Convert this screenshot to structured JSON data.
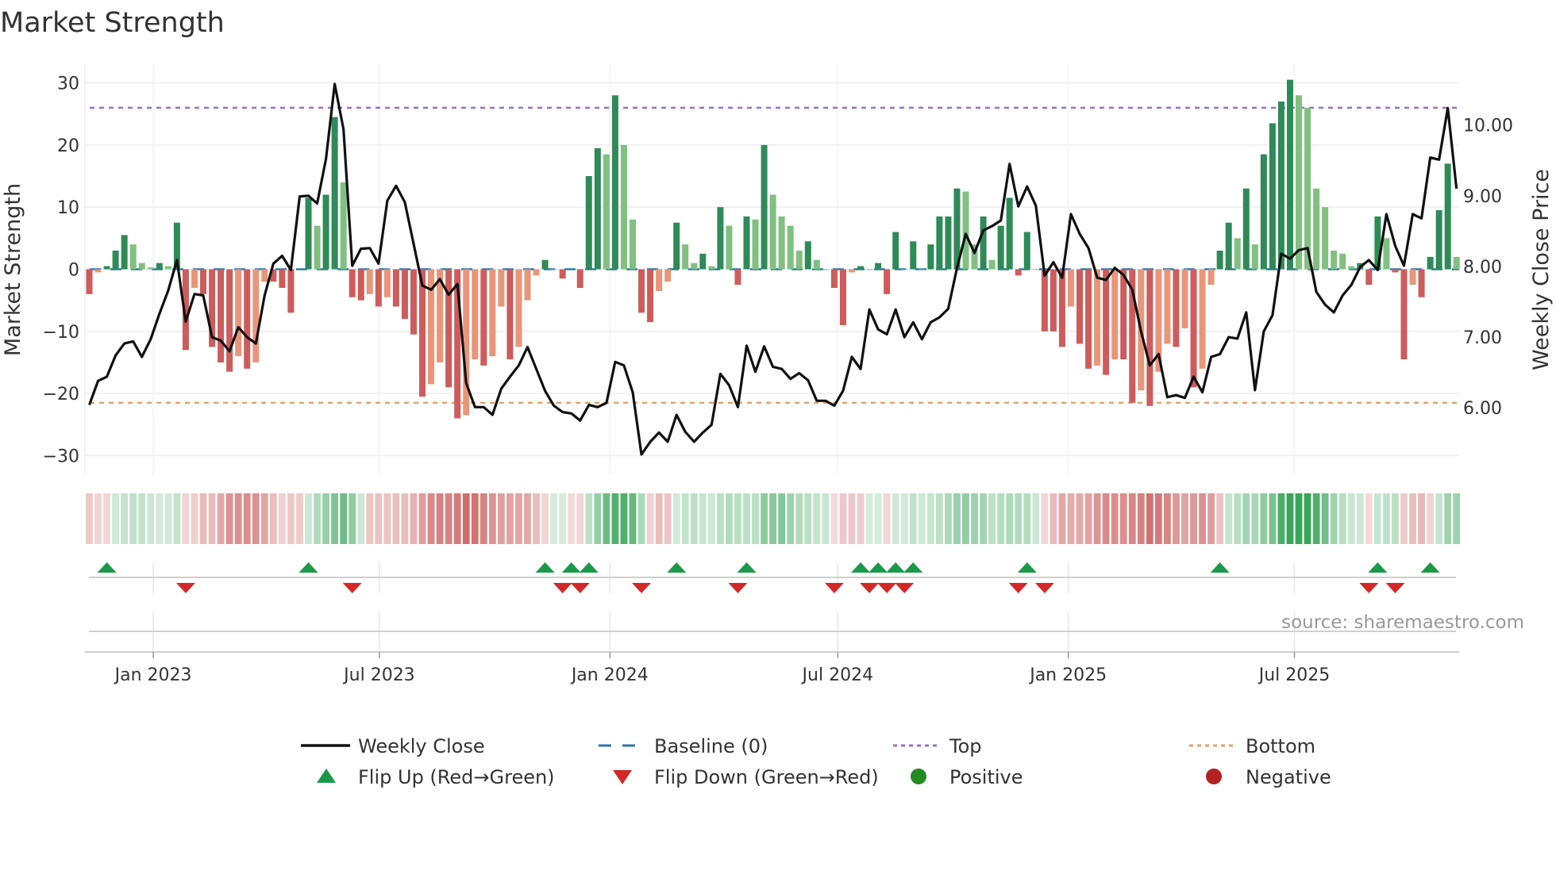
{
  "chart_data": {
    "type": "bar",
    "title": "Market Strength",
    "ylabel": "Market Strength",
    "y2label": "Weekly Close Price",
    "ylim": [
      -33,
      33
    ],
    "y2lim": [
      5.06,
      10.86
    ],
    "yticks": [
      30,
      20,
      10,
      0,
      -10,
      -20,
      -30
    ],
    "ytick_labels": [
      "30",
      "20",
      "10",
      "0",
      "−10",
      "−20",
      "−30"
    ],
    "y2ticks": [
      10,
      9,
      8,
      7,
      6
    ],
    "y2tick_labels": [
      "10.00",
      "9.00",
      "8.00",
      "7.00",
      "6.00"
    ],
    "xtick_labels": [
      "Jan 2023",
      "Jul 2023",
      "Jan 2024",
      "Jul 2024",
      "Jan 2025",
      "Jul 2025"
    ],
    "xtick_week_index": [
      7.3,
      33.1,
      59.4,
      85.4,
      111.7,
      137.5
    ],
    "grid": true,
    "top_level": 26,
    "bottom_level": -21.5,
    "baseline": 0,
    "strength": [
      -4,
      -0.5,
      0.5,
      3,
      5.5,
      4,
      1,
      0.3,
      1,
      0.5,
      7.5,
      -13,
      -3,
      -4,
      -12.5,
      -15,
      -16.5,
      -14,
      -16,
      -15,
      -2,
      -2,
      -3,
      -7,
      0,
      11.5,
      7,
      12,
      24.5,
      14,
      -4.5,
      -5,
      -4,
      -6,
      -4.5,
      -6,
      -8,
      -10.5,
      -20.5,
      -18.5,
      -15,
      -19,
      -24,
      -23.5,
      -14.5,
      -15.5,
      -14,
      -6,
      -14.5,
      -12.5,
      -5,
      -1,
      1.5,
      0,
      -1.5,
      0,
      -3,
      15,
      19.5,
      18.5,
      28,
      20,
      8,
      -7,
      -8.5,
      -3.5,
      -2,
      7.5,
      4,
      1,
      2.5,
      0.5,
      10,
      7,
      -2.5,
      8.5,
      8,
      20,
      12,
      8.5,
      7,
      3,
      4.5,
      1.5,
      0,
      -3,
      -9,
      -0.5,
      0.5,
      0,
      1,
      -4,
      6,
      0,
      4.5,
      0,
      4,
      8.5,
      8.5,
      13,
      12.5,
      4,
      8.5,
      1.5,
      7,
      11.5,
      -1,
      6,
      0,
      -10,
      -10,
      -12.5,
      -6,
      -12,
      -16,
      -15.5,
      -17,
      -14.5,
      -14.5,
      -21.5,
      -19.5,
      -22,
      -16.5,
      -12,
      -12.5,
      -9.5,
      -19,
      -16,
      -2.5,
      3,
      7.5,
      5,
      13,
      4,
      18.5,
      23.5,
      27,
      30.5,
      28,
      26,
      13,
      10,
      3,
      2.5,
      0.5,
      1,
      -2.5,
      8.5,
      5,
      -0.5,
      -14.5,
      -2.5,
      -4.5,
      2,
      9.5,
      17,
      2
    ],
    "weekly_close": [
      6.04,
      6.38,
      6.44,
      6.74,
      6.91,
      6.94,
      6.72,
      6.97,
      7.33,
      7.66,
      8.09,
      7.22,
      7.61,
      7.59,
      7.0,
      6.95,
      6.8,
      7.14,
      7.0,
      6.91,
      7.59,
      8.04,
      8.15,
      7.95,
      8.99,
      9.0,
      8.89,
      9.52,
      10.58,
      9.94,
      8.01,
      8.25,
      8.26,
      8.04,
      8.93,
      9.14,
      8.91,
      8.32,
      7.73,
      7.67,
      7.82,
      7.6,
      7.75,
      6.35,
      6.01,
      6.01,
      5.9,
      6.27,
      6.44,
      6.6,
      6.86,
      6.55,
      6.24,
      6.03,
      5.94,
      5.92,
      5.82,
      6.04,
      6.01,
      6.07,
      6.65,
      6.6,
      6.22,
      5.34,
      5.52,
      5.65,
      5.52,
      5.9,
      5.66,
      5.52,
      5.65,
      5.76,
      6.48,
      6.32,
      6.01,
      6.88,
      6.51,
      6.87,
      6.58,
      6.55,
      6.41,
      6.49,
      6.39,
      6.1,
      6.1,
      6.03,
      6.24,
      6.72,
      6.55,
      7.39,
      7.11,
      7.04,
      7.39,
      7.0,
      7.21,
      6.97,
      7.21,
      7.28,
      7.4,
      7.98,
      8.46,
      8.19,
      8.51,
      8.57,
      8.65,
      9.45,
      8.85,
      9.13,
      8.86,
      7.87,
      8.06,
      7.84,
      8.74,
      8.46,
      8.26,
      7.84,
      7.81,
      7.98,
      7.88,
      7.67,
      7.08,
      6.6,
      6.76,
      6.15,
      6.18,
      6.14,
      6.44,
      6.22,
      6.72,
      6.76,
      7.0,
      6.98,
      7.35,
      6.25,
      7.08,
      7.31,
      8.18,
      8.11,
      8.23,
      8.26,
      7.64,
      7.46,
      7.35,
      7.59,
      7.74,
      7.99,
      8.09,
      7.95,
      8.74,
      8.29,
      8.01,
      8.74,
      8.68,
      9.54,
      9.51,
      10.24,
      9.1
    ],
    "flip_up_week_index": [
      2,
      25,
      52,
      55,
      57,
      67,
      75,
      88,
      90,
      92,
      94,
      107,
      129,
      147,
      153
    ],
    "flip_down_week_index": [
      11,
      30,
      54,
      56,
      63,
      74,
      85,
      89,
      91,
      93,
      106,
      109,
      146,
      149
    ],
    "legend": {
      "placement": "bottom",
      "entries": [
        "Weekly Close",
        "Baseline (0)",
        "Top",
        "Bottom",
        "Flip Up (Red→Green)",
        "Flip Down (Green→Red)",
        "Positive",
        "Negative"
      ]
    },
    "source": "source: sharemaestro.com",
    "colors": {
      "pos_strong": "#2e8b57",
      "pos_weak": "#80c080",
      "neg_strong": "#cd5c5c",
      "neg_weak": "#e8967a",
      "line": "#111111",
      "baseline": "#2a7ab0",
      "top": "#9b6ddc",
      "bottom": "#e8a263",
      "flip_up": "#1a9a48",
      "flip_down": "#d62728",
      "positive": "#228b22",
      "negative": "#b22222"
    }
  }
}
